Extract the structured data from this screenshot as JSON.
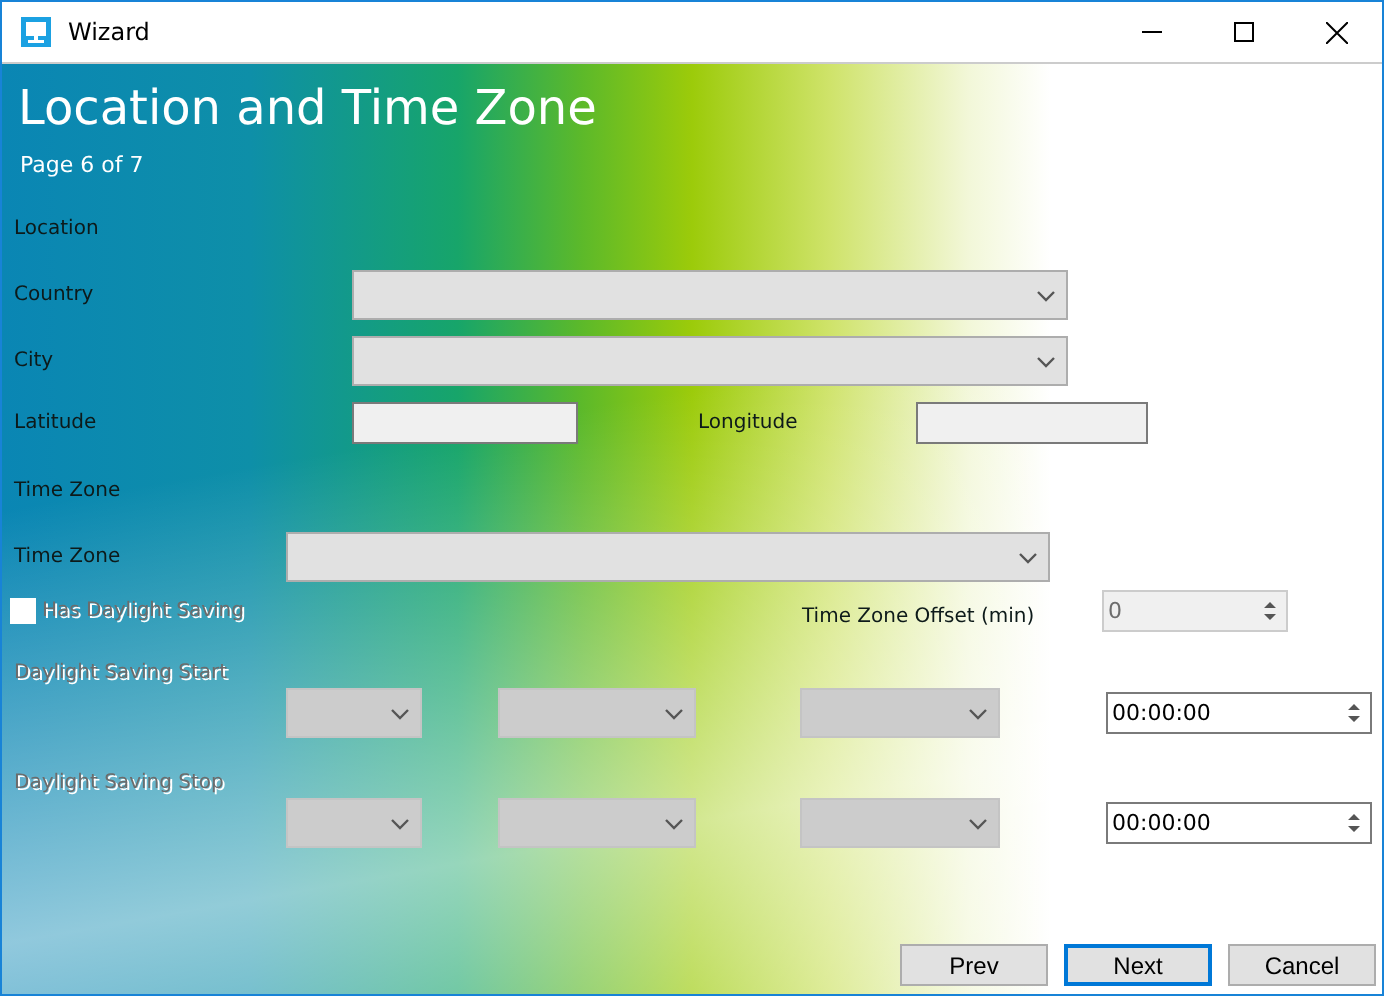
{
  "window": {
    "title": "Wizard"
  },
  "header": {
    "title": "Location and Time Zone",
    "page": "Page 6 of 7"
  },
  "location": {
    "heading": "Location",
    "country": {
      "label": "Country",
      "disabled": false
    },
    "city": {
      "label": "City",
      "disabled": false
    },
    "latitude": {
      "label": "Latitude"
    },
    "longitude": {
      "label": "Longitude"
    }
  },
  "time_zone": {
    "heading": "Time Zone",
    "zone": {
      "label": "Time Zone",
      "disabled": false
    },
    "daylight": {
      "label": "Has Daylight Saving",
      "checked": false
    },
    "offset": {
      "label": "Time Zone Offset (min)",
      "value": "0",
      "disabled": true
    }
  },
  "daylight_rows": [
    {
      "label": "Daylight Saving Start",
      "disabled": true,
      "time": "00:00:00"
    },
    {
      "label": "Daylight Saving Stop",
      "disabled": true,
      "time": "00:00:00"
    }
  ],
  "buttons": [
    {
      "label": "Prev",
      "default": false
    },
    {
      "label": "Next",
      "default": true
    },
    {
      "label": "Cancel",
      "default": false
    }
  ]
}
